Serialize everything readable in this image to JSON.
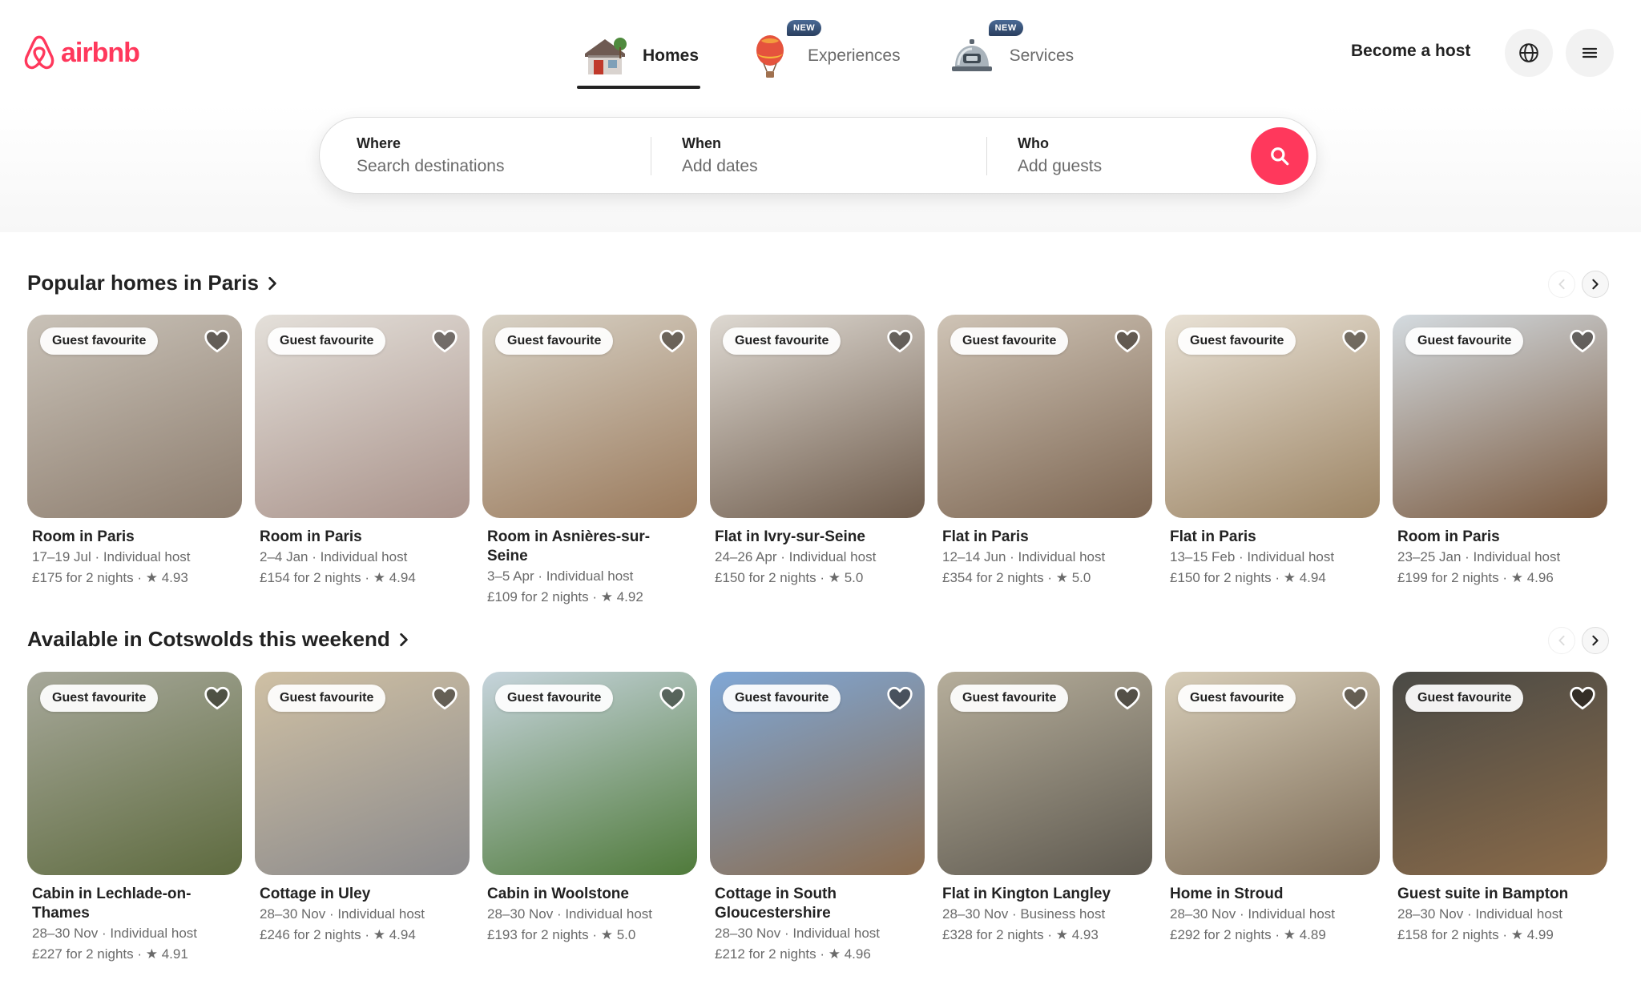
{
  "brand": {
    "name": "airbnb",
    "color": "#ff385c"
  },
  "nav": {
    "tabs": [
      {
        "label": "Homes",
        "icon": "house-icon",
        "active": true,
        "badge": ""
      },
      {
        "label": "Experiences",
        "icon": "hot-air-balloon-icon",
        "active": false,
        "badge": "NEW"
      },
      {
        "label": "Services",
        "icon": "service-bell-icon",
        "active": false,
        "badge": "NEW"
      }
    ],
    "become_host": "Become a host"
  },
  "search": {
    "where": {
      "label": "Where",
      "placeholder": "Search destinations"
    },
    "when": {
      "label": "When",
      "placeholder": "Add dates"
    },
    "who": {
      "label": "Who",
      "placeholder": "Add guests"
    }
  },
  "sections": [
    {
      "title": "Popular homes in Paris",
      "listings": [
        {
          "badge": "Guest favourite",
          "title": "Room in Paris",
          "sub": "17–19 Jul · Individual host",
          "price": "£175 for 2 nights · ★ 4.93",
          "photo": [
            "#c9c2b8",
            "#8d7d6e"
          ]
        },
        {
          "badge": "Guest favourite",
          "title": "Room in Paris",
          "sub": "2–4 Jan · Individual host",
          "price": "£154 for 2 nights · ★ 4.94",
          "photo": [
            "#e4e0da",
            "#a9928a"
          ]
        },
        {
          "badge": "Guest favourite",
          "title": "Room in Asnières-sur-Seine",
          "sub": "3–5 Apr · Individual host",
          "price": "£109 for 2 nights · ★ 4.92",
          "photo": [
            "#d8d2c6",
            "#9a7a5c"
          ]
        },
        {
          "badge": "Guest favourite",
          "title": "Flat in Ivry-sur-Seine",
          "sub": "24–26 Apr · Individual host",
          "price": "£150 for 2 nights · ★ 5.0",
          "photo": [
            "#ded9d2",
            "#6f5c4c"
          ]
        },
        {
          "badge": "Guest favourite",
          "title": "Flat in Paris",
          "sub": "12–14 Jun · Individual host",
          "price": "£354 for 2 nights · ★ 5.0",
          "photo": [
            "#cfc4b6",
            "#7d6652"
          ]
        },
        {
          "badge": "Guest favourite",
          "title": "Flat in Paris",
          "sub": "13–15 Feb · Individual host",
          "price": "£150 for 2 nights · ★ 4.94",
          "photo": [
            "#e8e1d5",
            "#9c8464"
          ]
        },
        {
          "badge": "Guest favourite",
          "title": "Room in Paris",
          "sub": "23–25 Jan · Individual host",
          "price": "£199 for 2 nights · ★ 4.96",
          "photo": [
            "#d4dbe0",
            "#7a5a40"
          ]
        }
      ]
    },
    {
      "title": "Available in Cotswolds this weekend",
      "listings": [
        {
          "badge": "Guest favourite",
          "title": "Cabin in Lechlade-on-Thames",
          "sub": "28–30 Nov · Individual host",
          "price": "£227 for 2 nights · ★ 4.91",
          "photo": [
            "#a7a89a",
            "#5e6b3f"
          ]
        },
        {
          "badge": "Guest favourite",
          "title": "Cottage in Uley",
          "sub": "28–30 Nov · Individual host",
          "price": "£246 for 2 nights · ★ 4.94",
          "photo": [
            "#cfc0a4",
            "#8b8a8c"
          ]
        },
        {
          "badge": "Guest favourite",
          "title": "Cabin in Woolstone",
          "sub": "28–30 Nov · Individual host",
          "price": "£193 for 2 nights · ★ 5.0",
          "photo": [
            "#c6d4dc",
            "#4f7a3a"
          ]
        },
        {
          "badge": "Guest favourite",
          "title": "Cottage in South Gloucestershire",
          "sub": "28–30 Nov · Individual host",
          "price": "£212 for 2 nights · ★ 4.96",
          "photo": [
            "#7fa7d6",
            "#8b6c4e"
          ]
        },
        {
          "badge": "Guest favourite",
          "title": "Flat in Kington Langley",
          "sub": "28–30 Nov · Business host",
          "price": "£328 for 2 nights · ★ 4.93",
          "photo": [
            "#b6ae9b",
            "#5f5a50"
          ]
        },
        {
          "badge": "Guest favourite",
          "title": "Home in Stroud",
          "sub": "28–30 Nov · Individual host",
          "price": "£292 for 2 nights · ★ 4.89",
          "photo": [
            "#d7cdb8",
            "#7b6a55"
          ]
        },
        {
          "badge": "Guest favourite",
          "title": "Guest suite in Bampton",
          "sub": "28–30 Nov · Individual host",
          "price": "£158 for 2 nights · ★ 4.99",
          "photo": [
            "#4a4a46",
            "#8a6a48"
          ]
        }
      ]
    }
  ]
}
